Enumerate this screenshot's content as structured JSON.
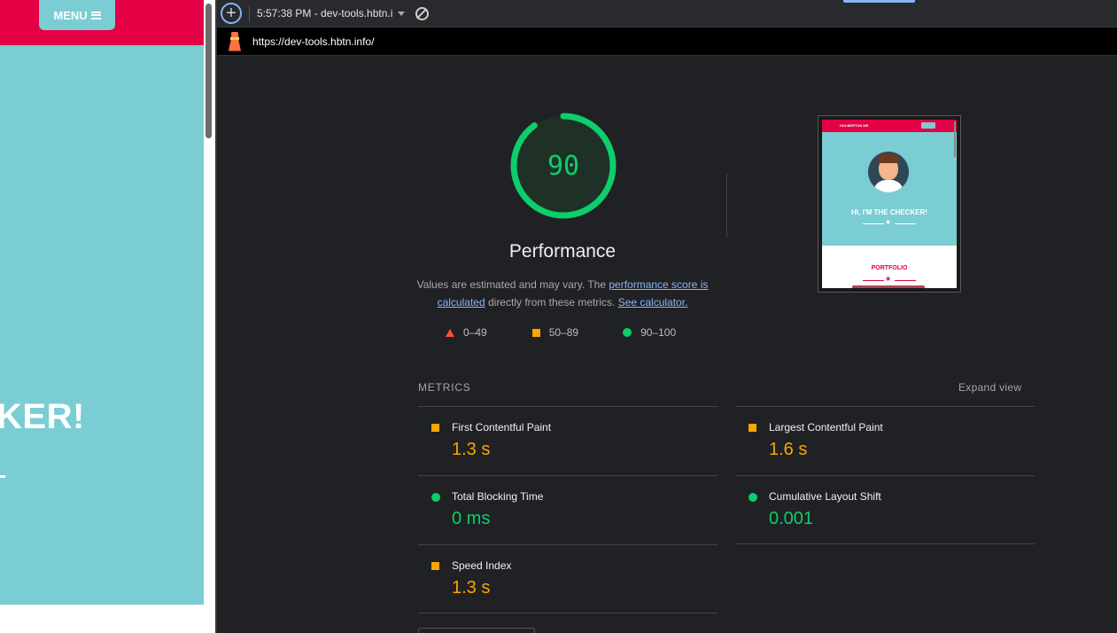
{
  "site": {
    "menu_label": "MENU",
    "hero_text": "KER!"
  },
  "toolbar": {
    "report_label": "5:57:38 PM - dev-tools.hbtn.i"
  },
  "urlbar": {
    "url": "https://dev-tools.hbtn.info/"
  },
  "gauge": {
    "score": "90",
    "score_fraction": 0.9,
    "color": "#0cce6b"
  },
  "performance": {
    "title": "Performance",
    "desc_prefix": "Values are estimated and may vary. The ",
    "desc_link1": "performance score is calculated",
    "desc_mid": " directly from these metrics. ",
    "desc_link2": "See calculator."
  },
  "legend": {
    "fail": "0–49",
    "average": "50–89",
    "pass": "90–100"
  },
  "thumbnail": {
    "brand": "HOLBERTON ME",
    "hero_text": "HI, I'M THE CHECKER!",
    "portfolio": "PORTFOLIO"
  },
  "metrics": {
    "label": "METRICS",
    "expand": "Expand view",
    "items": [
      {
        "name": "First Contentful Paint",
        "value": "1.3 s",
        "status": "average",
        "color": "#ffa400"
      },
      {
        "name": "Largest Contentful Paint",
        "value": "1.6 s",
        "status": "average",
        "color": "#ffa400"
      },
      {
        "name": "Total Blocking Time",
        "value": "0 ms",
        "status": "pass",
        "color": "#0cce6b"
      },
      {
        "name": "Cumulative Layout Shift",
        "value": "0.001",
        "status": "pass",
        "color": "#0cce6b"
      },
      {
        "name": "Speed Index",
        "value": "1.3 s",
        "status": "average",
        "color": "#ffa400"
      }
    ]
  }
}
